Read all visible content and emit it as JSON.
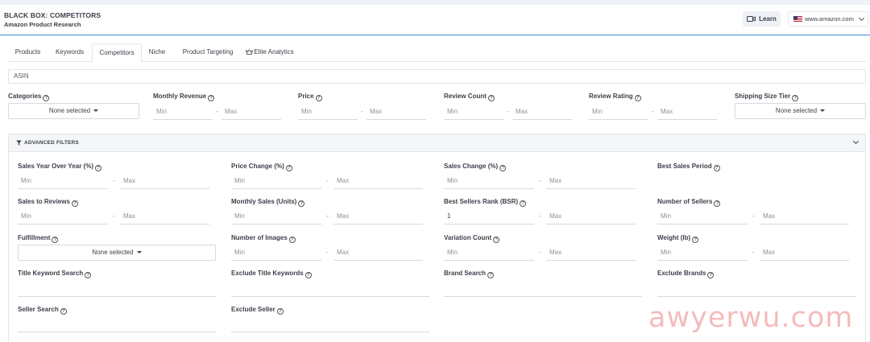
{
  "header": {
    "title": "BLACK BOX: COMPETITORS",
    "subtitle": "Amazon Product Research",
    "learn_label": "Learn",
    "marketplace": "www.amazon.com"
  },
  "tabs": [
    "Products",
    "Keywords",
    "Competitors",
    "Niche",
    "Product Targeting",
    "Elite Analytics"
  ],
  "active_tab": "Competitors",
  "asin_placeholder": "ASIN",
  "filters": {
    "categories": {
      "label": "Categories",
      "value": "None selected"
    },
    "monthly_revenue": {
      "label": "Monthly Revenue",
      "min": "Min",
      "max": "Max"
    },
    "price": {
      "label": "Price",
      "min": "Min",
      "max": "Max"
    },
    "review_count": {
      "label": "Review Count",
      "min": "Min",
      "max": "Max"
    },
    "review_rating": {
      "label": "Review Rating",
      "min": "Min",
      "max": "Max"
    },
    "shipping_size_tier": {
      "label": "Shipping Size Tier",
      "value": "None selected"
    }
  },
  "advanced": {
    "title": "ADVANCED FILTERS",
    "sales_yoy": {
      "label": "Sales Year Over Year (%)",
      "min": "Min",
      "max": "Max"
    },
    "price_change": {
      "label": "Price Change (%)",
      "min": "Min",
      "max": "Max"
    },
    "sales_change": {
      "label": "Sales Change (%)",
      "min": "Min",
      "max": "Max"
    },
    "best_sales_period": {
      "label": "Best Sales Period"
    },
    "sales_to_reviews": {
      "label": "Sales to Reviews",
      "min": "Min",
      "max": "Max"
    },
    "monthly_sales": {
      "label": "Monthly Sales (Units)",
      "min": "Min",
      "max": "Max"
    },
    "bsr": {
      "label": "Best Sellers Rank (BSR)",
      "min": "1",
      "max": "Max"
    },
    "number_of_sellers": {
      "label": "Number of Sellers",
      "min": "Min",
      "max": "Max"
    },
    "fulfillment": {
      "label": "Fulfillment",
      "value": "None selected"
    },
    "number_of_images": {
      "label": "Number of Images",
      "min": "Min",
      "max": "Max"
    },
    "variation_count": {
      "label": "Variation Count",
      "min": "Min",
      "max": "Max"
    },
    "weight": {
      "label": "Weight (lb)",
      "min": "Min",
      "max": "Max"
    },
    "title_keyword_search": {
      "label": "Title Keyword Search"
    },
    "exclude_title_keywords": {
      "label": "Exclude Title Keywords"
    },
    "brand_search": {
      "label": "Brand Search"
    },
    "exclude_brands": {
      "label": "Exclude Brands"
    },
    "seller_search": {
      "label": "Seller Search"
    },
    "exclude_seller": {
      "label": "Exclude Seller"
    }
  },
  "watermark": "awyerwu.com"
}
